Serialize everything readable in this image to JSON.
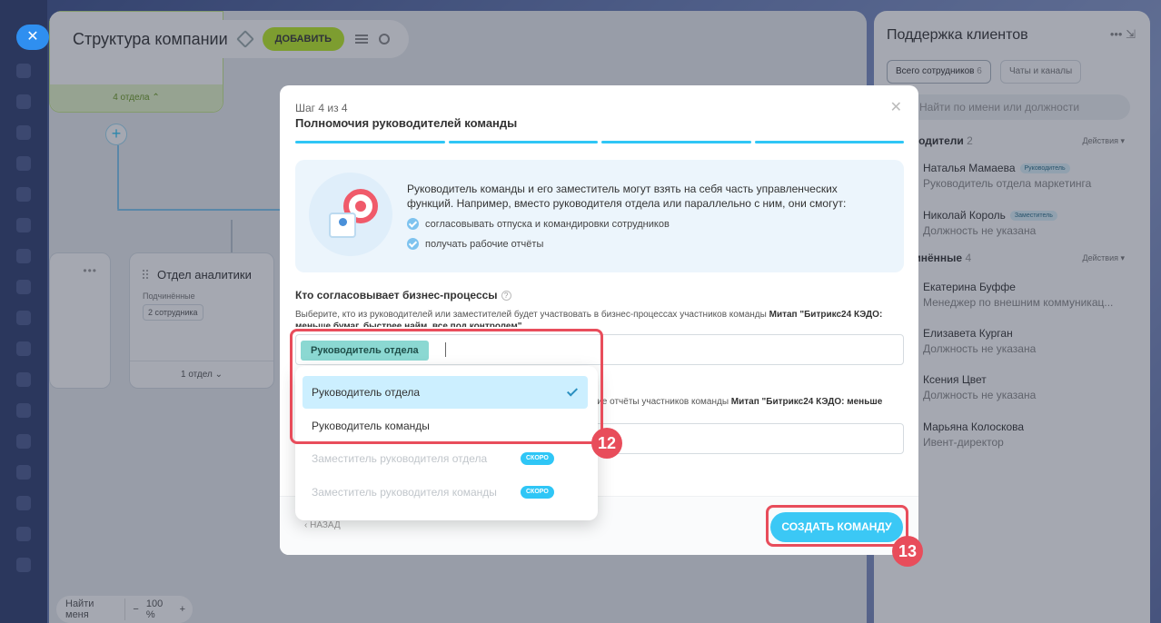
{
  "workspace": {
    "title": "Структура компании",
    "add_label": "ДОБАВИТЬ",
    "top_card_band": "4 отдела",
    "dept_title": "Отдел аналитики",
    "dept_sub": "Подчинённые",
    "dept_chip": "2 сотрудника",
    "dept_foot": "1 отдел",
    "find_me": "Найти меня",
    "zoom": "100 %"
  },
  "support": {
    "title": "Поддержка клиентов",
    "tab_all": "Всего сотрудников",
    "tab_all_count": "6",
    "tab_chats": "Чаты и каналы",
    "search_placeholder": "Найти по имени или должности",
    "section_heads": "Руководители",
    "section_heads_count": "2",
    "section_subs": "Подчинённые",
    "section_subs_count": "4",
    "actions_label": "Действия",
    "people": [
      {
        "name": "Наталья Мамаева",
        "role": "Руководитель отдела маркетинга",
        "badge": "Руководитель"
      },
      {
        "name": "Николай Король",
        "role": "Должность не указана",
        "badge": "Заместитель"
      },
      {
        "name": "Екатерина Буффе",
        "role": "Менеджер по внешним коммуникац...",
        "badge": ""
      },
      {
        "name": "Елизавета Курган",
        "role": "Должность не указана",
        "badge": ""
      },
      {
        "name": "Ксения Цвет",
        "role": "Должность не указана",
        "badge": ""
      },
      {
        "name": "Марьяна Колоскова",
        "role": "Ивент-директор",
        "badge": ""
      }
    ]
  },
  "modal": {
    "step": "Шаг 4 из 4",
    "title": "Полномочия руководителей команды",
    "info_text": "Руководитель команды и его заместитель могут взять на себя часть управленческих функций. Например, вместо руководителя отдела или параллельно с ним, они смогут:",
    "bullets": [
      "согласовывать отпуска и командировки сотрудников",
      "получать рабочие отчёты"
    ],
    "q1_label": "Кто согласовывает бизнес-процессы",
    "q1_desc_prefix": "Выберите, кто из руководителей или заместителей будет участвовать в бизнес-процессах участников команды ",
    "q1_desc_bold": "Митап \"Битрикс24 КЭДО: меньше бумаг, быстрее найм, все под контролем\"",
    "q1_selected_chip": "Руководитель отдела",
    "q2_desc_prefix": "чие отчёты участников команды ",
    "q2_desc_bold": "Митап \"Битрикс24 КЭДО: меньше",
    "back_label": "НАЗАД",
    "create_label": "СОЗДАТЬ КОМАНДУ"
  },
  "dropdown": {
    "items": [
      {
        "label": "Руководитель отдела",
        "state": "selected"
      },
      {
        "label": "Руководитель команды",
        "state": "normal"
      },
      {
        "label": "Заместитель руководителя отдела",
        "state": "disabled",
        "tag": "СКОРО"
      },
      {
        "label": "Заместитель руководителя команды",
        "state": "disabled",
        "tag": "СКОРО"
      }
    ]
  },
  "annotations": {
    "step_a": "12",
    "step_b": "13"
  },
  "colors": {
    "accent": "#2fc6f6",
    "highlight": "#e84d5b",
    "add_button": "#bbed21"
  }
}
